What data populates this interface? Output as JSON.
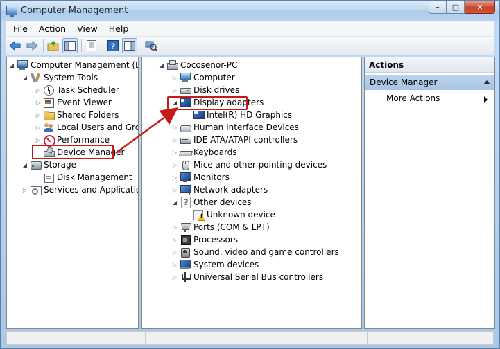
{
  "window": {
    "title": "Computer Management",
    "buttons": {
      "minimize": "–",
      "maximize": "□",
      "close": "✕"
    }
  },
  "menu": [
    "File",
    "Action",
    "View",
    "Help"
  ],
  "toolbar": {
    "icons": [
      "back-icon",
      "forward-icon",
      "up-folder-icon",
      "show-hide-tree-icon",
      "properties-icon",
      "help-icon",
      "show-hide-action-pane-icon",
      "scan-hardware-icon"
    ]
  },
  "left_tree": [
    {
      "label": "Computer Management (Local",
      "icon": "computer-management-icon",
      "expander": "expanded",
      "indent": 0
    },
    {
      "label": "System Tools",
      "icon": "system-tools-icon",
      "expander": "expanded",
      "indent": 1
    },
    {
      "label": "Task Scheduler",
      "icon": "task-scheduler-icon",
      "expander": "collapsed",
      "indent": 2
    },
    {
      "label": "Event Viewer",
      "icon": "event-viewer-icon",
      "expander": "collapsed",
      "indent": 2
    },
    {
      "label": "Shared Folders",
      "icon": "shared-folders-icon",
      "expander": "collapsed",
      "indent": 2
    },
    {
      "label": "Local Users and Groups",
      "icon": "local-users-icon",
      "expander": "collapsed",
      "indent": 2
    },
    {
      "label": "Performance",
      "icon": "performance-icon",
      "expander": "collapsed",
      "indent": 2
    },
    {
      "label": "Device Manager",
      "icon": "device-manager-icon",
      "expander": "none",
      "indent": 2
    },
    {
      "label": "Storage",
      "icon": "storage-icon",
      "expander": "expanded",
      "indent": 1
    },
    {
      "label": "Disk Management",
      "icon": "disk-management-icon",
      "expander": "none",
      "indent": 2
    },
    {
      "label": "Services and Applications",
      "icon": "services-applications-icon",
      "expander": "collapsed",
      "indent": 1
    }
  ],
  "device_tree": [
    {
      "label": "Cocosenor-PC",
      "icon": "pc-icon",
      "expander": "expanded",
      "indent": 0
    },
    {
      "label": "Computer",
      "icon": "computer-icon",
      "expander": "collapsed",
      "indent": 1
    },
    {
      "label": "Disk drives",
      "icon": "disk-drive-icon",
      "expander": "collapsed",
      "indent": 1
    },
    {
      "label": "Display adapters",
      "icon": "display-adapter-icon",
      "expander": "expanded",
      "indent": 1
    },
    {
      "label": "Intel(R) HD Graphics",
      "icon": "display-adapter-icon",
      "expander": "none",
      "indent": 2
    },
    {
      "label": "Human Interface Devices",
      "icon": "hid-icon",
      "expander": "collapsed",
      "indent": 1
    },
    {
      "label": "IDE ATA/ATAPI controllers",
      "icon": "ide-controller-icon",
      "expander": "collapsed",
      "indent": 1
    },
    {
      "label": "Keyboards",
      "icon": "keyboard-icon",
      "expander": "collapsed",
      "indent": 1
    },
    {
      "label": "Mice and other pointing devices",
      "icon": "mouse-icon",
      "expander": "collapsed",
      "indent": 1
    },
    {
      "label": "Monitors",
      "icon": "monitor-icon",
      "expander": "collapsed",
      "indent": 1
    },
    {
      "label": "Network adapters",
      "icon": "network-adapter-icon",
      "expander": "collapsed",
      "indent": 1
    },
    {
      "label": "Other devices",
      "icon": "other-devices-icon",
      "expander": "expanded",
      "indent": 1
    },
    {
      "label": "Unknown device",
      "icon": "unknown-device-icon",
      "expander": "none",
      "indent": 2
    },
    {
      "label": "Ports (COM & LPT)",
      "icon": "ports-icon",
      "expander": "collapsed",
      "indent": 1
    },
    {
      "label": "Processors",
      "icon": "processor-icon",
      "expander": "collapsed",
      "indent": 1
    },
    {
      "label": "Sound, video and game controllers",
      "icon": "sound-icon",
      "expander": "collapsed",
      "indent": 1
    },
    {
      "label": "System devices",
      "icon": "system-devices-icon",
      "expander": "collapsed",
      "indent": 1
    },
    {
      "label": "Universal Serial Bus controllers",
      "icon": "usb-icon",
      "expander": "collapsed",
      "indent": 1
    }
  ],
  "actions": {
    "title": "Actions",
    "section": "Device Manager",
    "more": "More Actions"
  },
  "colors": {
    "highlight_border": "#c41a1a",
    "annotation_arrow": "#c41a1a",
    "actions_section_bg": "#bcd3ec"
  }
}
